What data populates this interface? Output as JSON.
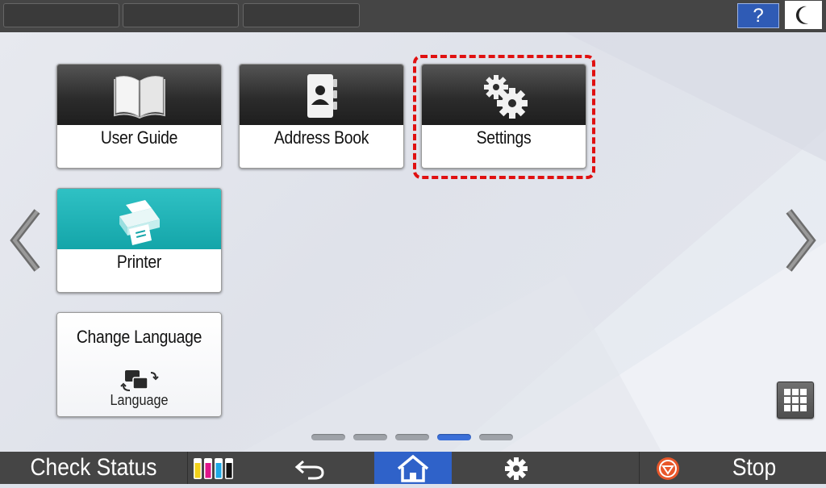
{
  "tiles": {
    "user_guide": "User Guide",
    "address_book": "Address Book",
    "settings": "Settings",
    "printer": "Printer",
    "change_language": "Change Language",
    "language_caption": "Language"
  },
  "topbar": {
    "help_label": "?"
  },
  "pagination": {
    "page_count": 5,
    "active_index": 3
  },
  "bottombar": {
    "check_status": "Check Status",
    "stop": "Stop"
  },
  "colors": {
    "accent_blue": "#2f62c9",
    "highlight_red": "#e01010",
    "printer_teal": "#14a5a9",
    "bar_dark": "#454545"
  },
  "icons": {
    "user_guide": "book-icon",
    "address_book": "address-book-icon",
    "settings": "gears-icon",
    "printer": "printer-icon",
    "language": "language-switch-icon",
    "back": "back-arrow-icon",
    "home": "home-icon",
    "gear": "gear-icon",
    "stop": "stop-icon",
    "apps": "app-grid-icon",
    "sleep": "moon-icon"
  }
}
